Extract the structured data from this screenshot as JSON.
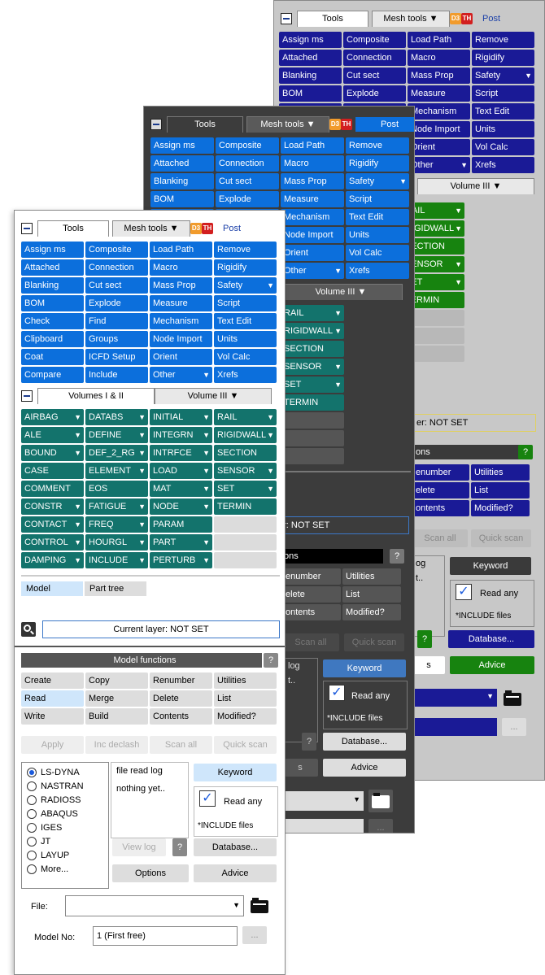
{
  "tabs": {
    "tools": "Tools",
    "mesh_tools": "Mesh tools",
    "d3": "D3",
    "th": "TH",
    "post": "Post"
  },
  "tools_buttons": [
    [
      "Assign ms",
      "Composite",
      "Load Path",
      "Remove"
    ],
    [
      "Attached",
      "Connection",
      "Macro",
      "Rigidify"
    ],
    [
      "Blanking",
      "Cut sect",
      "Mass Prop",
      "Safety"
    ],
    [
      "BOM",
      "Explode",
      "Measure",
      "Script"
    ],
    [
      "Check",
      "Find",
      "Mechanism",
      "Text Edit"
    ],
    [
      "Clipboard",
      "Groups",
      "Node Import",
      "Units"
    ],
    [
      "Coat",
      "ICFD Setup",
      "Orient",
      "Vol Calc"
    ],
    [
      "Compare",
      "Include",
      "Other",
      "Xrefs"
    ]
  ],
  "volume_tabs": {
    "vol12": "Volumes I & II",
    "vol3": "Volume III"
  },
  "keyword_buttons": [
    [
      "AIRBAG",
      "DATABS",
      "INITIAL",
      "RAIL"
    ],
    [
      "ALE",
      "DEFINE",
      "INTEGRN",
      "RIGIDWALL"
    ],
    [
      "BOUND",
      "DEF_2_RG",
      "INTRFCE",
      "SECTION"
    ],
    [
      "CASE",
      "ELEMENT",
      "LOAD",
      "SENSOR"
    ],
    [
      "COMMENT",
      "EOS",
      "MAT",
      "SET"
    ],
    [
      "CONSTR",
      "FATIGUE",
      "NODE",
      "TERMIN"
    ],
    [
      "CONTACT",
      "FREQ",
      "PARAM",
      ""
    ],
    [
      "CONTROL",
      "HOURGL",
      "PART",
      ""
    ],
    [
      "DAMPING",
      "INCLUDE",
      "PERTURB",
      ""
    ]
  ],
  "model_tree": {
    "model": "Model",
    "part_tree": "Part tree"
  },
  "status": {
    "layer": "Current layer: NOT SET",
    "layer_partial": "er: NOT SET",
    "layer_partial2": "er: NOT SET"
  },
  "model_functions": {
    "title": "Model functions",
    "help": "?",
    "rows": [
      [
        "Create",
        "Copy",
        "Renumber",
        "Utilities"
      ],
      [
        "Read",
        "Merge",
        "Delete",
        "List"
      ],
      [
        "Write",
        "Build",
        "Contents",
        "Modified?"
      ]
    ],
    "actions": [
      "Apply",
      "Inc declash",
      "Scan all",
      "Quick scan"
    ]
  },
  "formats": [
    "LS-DYNA",
    "NASTRAN",
    "RADIOSS",
    "ABAQUS",
    "IGES",
    "JT",
    "LAYUP",
    "More..."
  ],
  "read_panel": {
    "log_title": "file read log",
    "log_text": "nothing yet..",
    "view_log": "View log",
    "help": "?",
    "keyword": "Keyword",
    "read_any": "Read any",
    "include_files": "*INCLUDE files",
    "database": "Database...",
    "options": "Options",
    "advice": "Advice"
  },
  "file": {
    "label": "File:",
    "value": "",
    "model_label": "Model No:",
    "model_value": "1 (First free)",
    "more": "..."
  },
  "dark_partial": {
    "section_title": "ons",
    "renumber": "enumber",
    "delete": "elete",
    "contents": "ontents",
    "log": "log",
    "log_text": "t..",
    "s": "s"
  },
  "gray_partial": {
    "section_title": "ons",
    "renumber": "enumber",
    "delete": "elete",
    "contents": "ontents",
    "log": "og",
    "log_text": "t..",
    "s": "s"
  }
}
